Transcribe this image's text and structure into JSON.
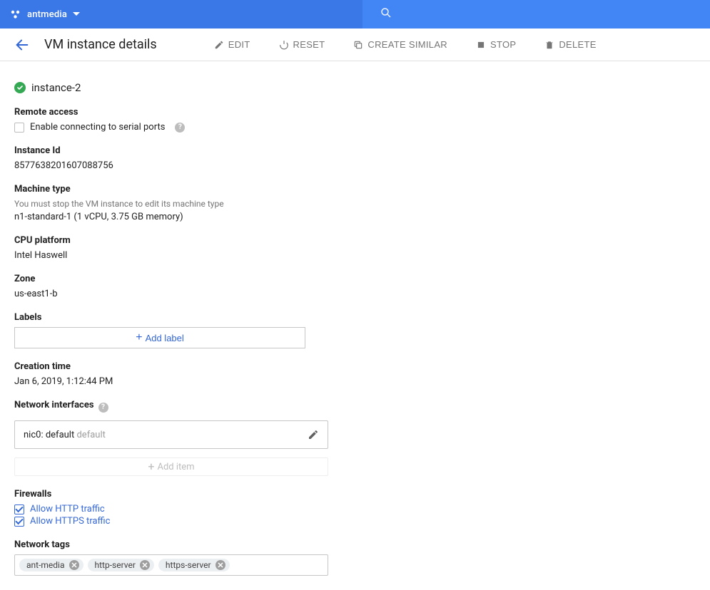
{
  "topbar": {
    "project": "antmedia"
  },
  "header": {
    "title": "VM instance details",
    "actions": {
      "edit": "EDIT",
      "reset": "RESET",
      "create_similar": "CREATE SIMILAR",
      "stop": "STOP",
      "delete": "DELETE"
    }
  },
  "instance": {
    "name": "instance-2",
    "remote_access": {
      "label": "Remote access",
      "serial_label": "Enable connecting to serial ports"
    },
    "id": {
      "label": "Instance Id",
      "value": "8577638201607088756"
    },
    "machine_type": {
      "label": "Machine type",
      "note": "You must stop the VM instance to edit its machine type",
      "value": "n1-standard-1 (1 vCPU, 3.75 GB memory)"
    },
    "cpu_platform": {
      "label": "CPU platform",
      "value": "Intel Haswell"
    },
    "zone": {
      "label": "Zone",
      "value": "us-east1-b"
    },
    "labels": {
      "label": "Labels",
      "add_button": "Add label"
    },
    "creation_time": {
      "label": "Creation time",
      "value": "Jan 6, 2019, 1:12:44 PM"
    },
    "network_interfaces": {
      "label": "Network interfaces",
      "nic_primary": "nic0: default",
      "nic_secondary": "default",
      "add_item": "Add item"
    },
    "firewalls": {
      "label": "Firewalls",
      "http": "Allow HTTP traffic",
      "https": "Allow HTTPS traffic"
    },
    "network_tags": {
      "label": "Network tags",
      "tags": [
        "ant-media",
        "http-server",
        "https-server"
      ]
    }
  }
}
